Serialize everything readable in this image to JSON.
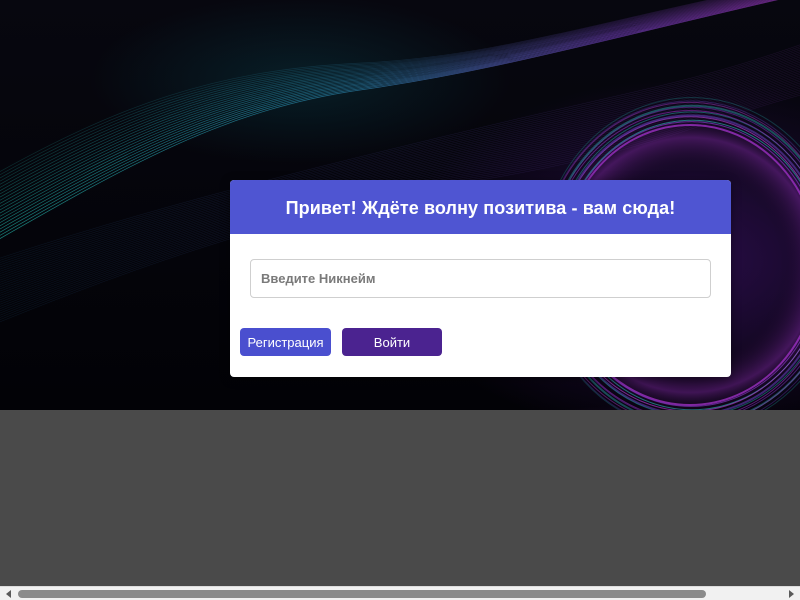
{
  "login_card": {
    "title": "Привет! Ждёте волну позитива - вам сюда!",
    "nickname_placeholder": "Введите Никнейм",
    "nickname_value": "",
    "register_label": "Регистрация",
    "login_label": "Войти"
  },
  "colors": {
    "header": "#4f55d2",
    "register_button": "#4a4fcf",
    "login_button": "#4b2390",
    "page_background": "#4a4a4a"
  },
  "icons": {
    "scroll_left": "scroll-left-arrow-icon",
    "scroll_right": "scroll-right-arrow-icon"
  }
}
